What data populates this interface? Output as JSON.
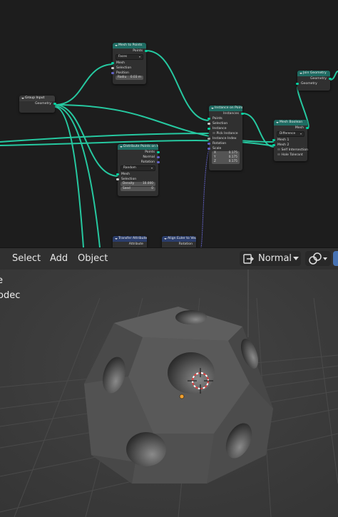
{
  "nodes": {
    "group_input": {
      "title": "Group Input",
      "outputs": [
        "Geometry"
      ]
    },
    "mesh_to_points": {
      "title": "Mesh to Points",
      "output": "Points",
      "mode": "Faces",
      "inputs": [
        "Mesh",
        "Selection",
        "Position"
      ],
      "radius_label": "Radiu",
      "radius_value": "0.03 m"
    },
    "distribute": {
      "title": "Distribute Points on Fac",
      "outputs": [
        "Points",
        "Normal",
        "Rotation"
      ],
      "mode": "Random",
      "inputs": [
        "Mesh",
        "Selection"
      ],
      "density_label": "Density",
      "density_value": "10.000",
      "seed_label": "Seed",
      "seed_value": "0"
    },
    "instance_on_points": {
      "title": "Instance on Points",
      "output": "Instances",
      "inputs": [
        "Points",
        "Selection",
        "Instance"
      ],
      "pick_instance": "Pick Instance",
      "inputs2": [
        "Instance Index",
        "Rotation",
        "Scale"
      ],
      "scale": [
        {
          "axis": "X",
          "value": "0.175"
        },
        {
          "axis": "Y",
          "value": "0.175"
        },
        {
          "axis": "Z",
          "value": "0.175"
        }
      ]
    },
    "mesh_boolean": {
      "title": "Mesh Boolean",
      "output": "Mesh",
      "mode": "Difference",
      "inputs": [
        "Mesh 1",
        "Mesh 2"
      ],
      "checks": [
        "Self Intersection",
        "Hole Tolerant"
      ]
    },
    "join_geometry": {
      "title": "Join Geometry",
      "output": "Geometry",
      "input": "Geometry"
    },
    "transfer_attribute": {
      "title": "Transfer Attribute",
      "output": "Attribute"
    },
    "align_euler": {
      "title": "Align Euler to Vect",
      "output": "Rotation"
    }
  },
  "header": {
    "menus": [
      "Select",
      "Add",
      "Object"
    ],
    "transform_orientation": "Normal"
  },
  "overlay": {
    "line1": "e",
    "line2": "odec"
  },
  "colors": {
    "geometry_socket": "#00d6a3",
    "vector_socket": "#6363c7",
    "geometry_header": "#1f6b62",
    "active_button": "#4772b3",
    "origin": "#f0a030"
  }
}
